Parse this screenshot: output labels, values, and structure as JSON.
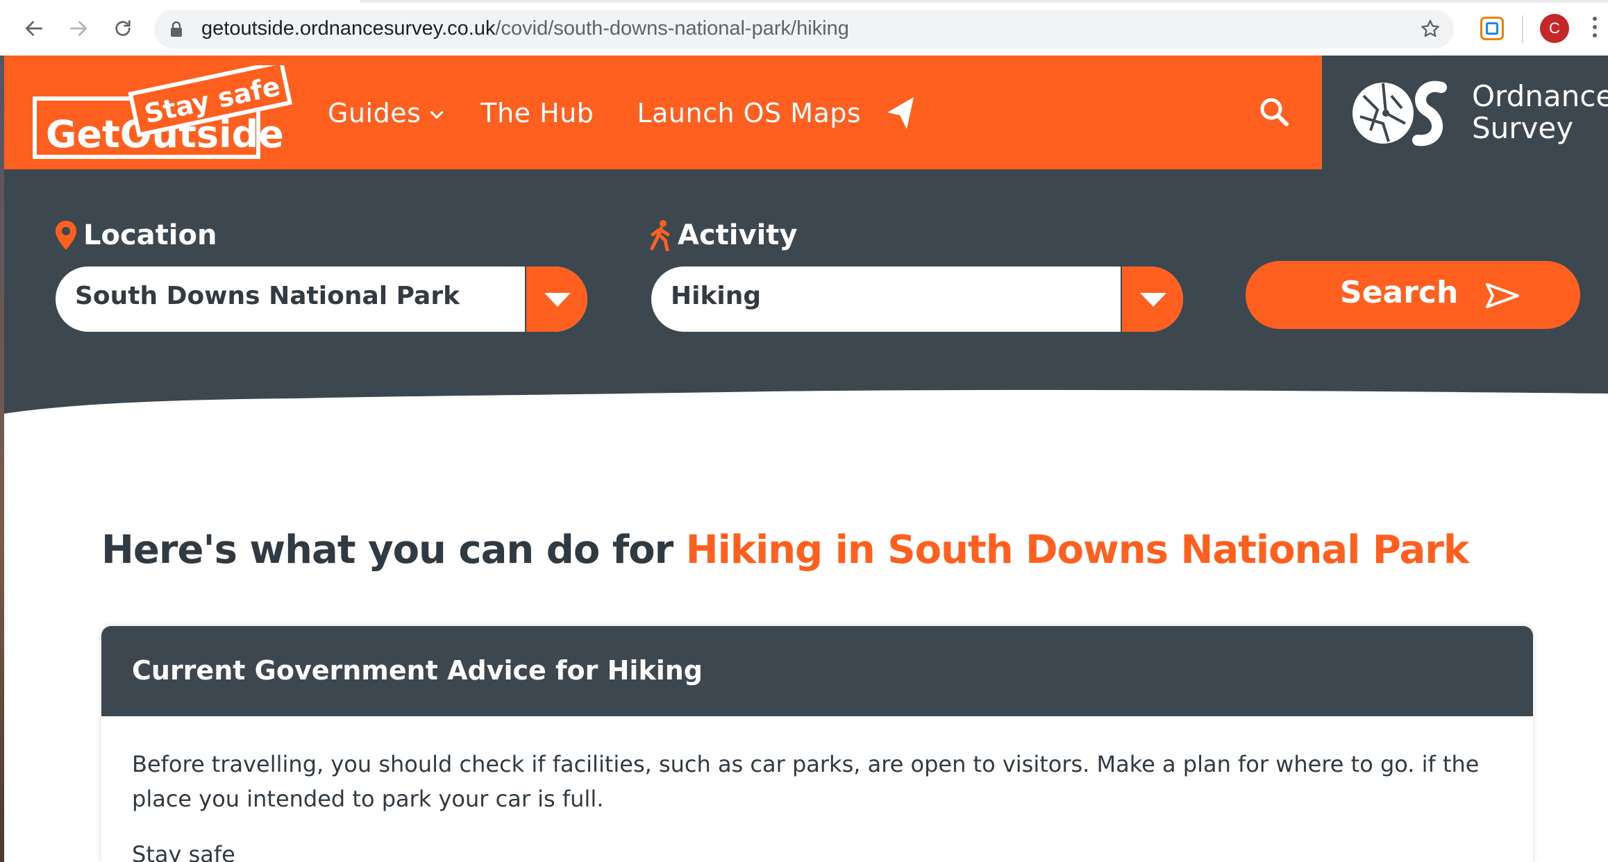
{
  "browser": {
    "url_domain": "getoutside.ordnancesurvey.co.uk",
    "url_path": "/covid/south-downs-national-park/hiking",
    "profile_initial": "C"
  },
  "header": {
    "logo_top": "Stay safe",
    "logo_bottom": "GetOutside",
    "nav": [
      {
        "label": "Guides"
      },
      {
        "label": "The Hub"
      },
      {
        "label": "Launch OS Maps"
      }
    ],
    "brand_line1": "Ordnance",
    "brand_line2": "Survey"
  },
  "search_panel": {
    "location_label": "Location",
    "location_value": "South Downs National Park",
    "activity_label": "Activity",
    "activity_value": "Hiking",
    "search_label": "Search"
  },
  "main": {
    "heading_prefix": "Here's what you can do for ",
    "heading_highlight": "Hiking in South Downs National Park",
    "advice_title": "Current Government Advice for Hiking",
    "advice_text": "Before travelling, you should check if facilities, such as car parks, are open to visitors. Make a plan for where to go. if the place you intended to park your car is full.",
    "advice_subheading": "Stay safe"
  },
  "colors": {
    "brand_orange": "#ff5f1f",
    "slate": "#3d4750",
    "text_dark": "#2f3a42"
  }
}
